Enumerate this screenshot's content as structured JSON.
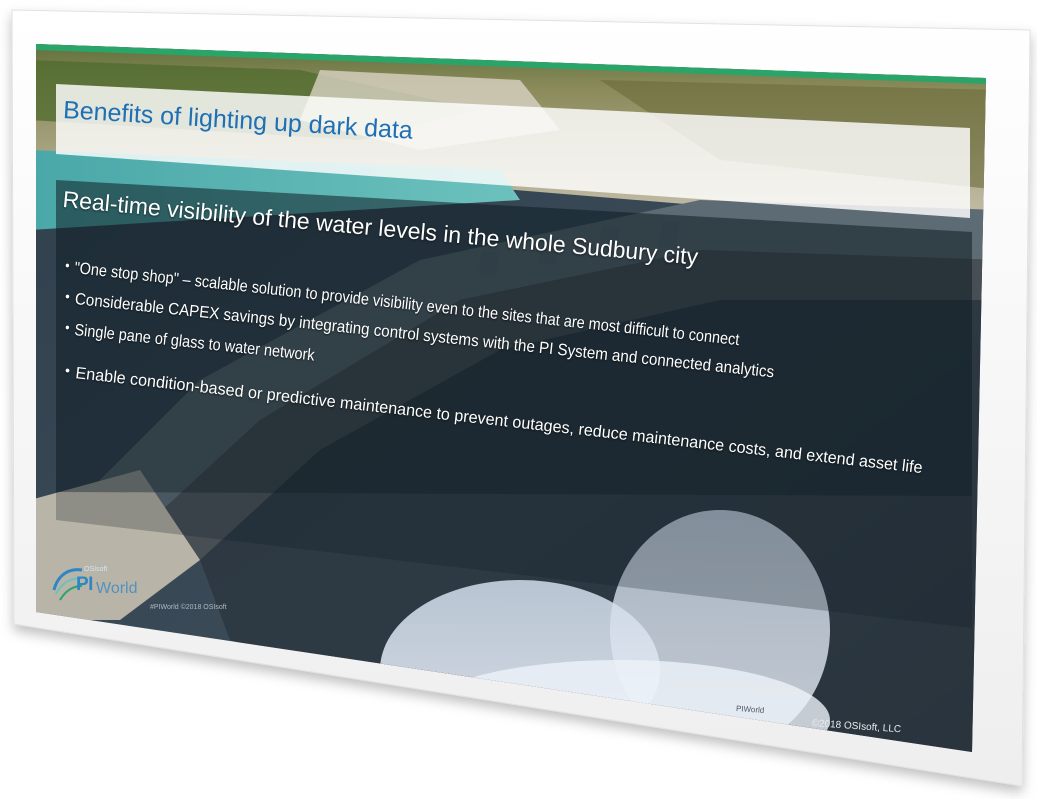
{
  "slide": {
    "title": "Benefits of lighting up dark data",
    "headline": "Real-time visibility of the water levels in the whole Sudbury city",
    "bullet_glyph": "•",
    "bullets": [
      "\"One stop shop\" – scalable solution to provide visibility even to the sites that are most difficult to connect",
      "Considerable CAPEX savings by integrating control systems with the PI System and connected analytics",
      "Single pane of glass to water network",
      "Enable condition-based or predictive maintenance to prevent outages, reduce maintenance costs, and extend asset life"
    ]
  },
  "logo": {
    "brand": "OSIsoft",
    "pi": "PI",
    "world": "World"
  },
  "footer": {
    "left": "#PIWorld ©2018 OSIsoft",
    "mid": "PIWorld",
    "copyright": "©2018 OSIsoft, LLC"
  },
  "colors": {
    "title_blue": "#1f6fb4",
    "logo_blue": "#2f86c6",
    "accent_green": "#2aa56a"
  }
}
